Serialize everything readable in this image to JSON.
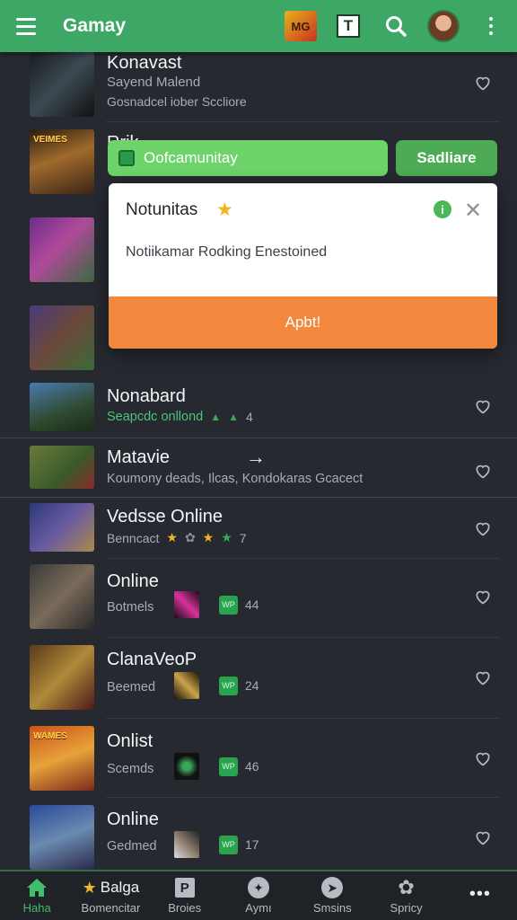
{
  "appbar": {
    "title": "Gamay",
    "logo_text": "MG",
    "t_icon": "T"
  },
  "promo": {
    "input_text": "Oofcamunitay",
    "button_label": "Sadliare"
  },
  "dialog": {
    "title": "Notunitas",
    "star": "★",
    "info": "i",
    "body": "Notiikamar Rodking Enestoined",
    "action": "Apbt!"
  },
  "rows": [
    {
      "title": "Konavast",
      "subtitle": "Sayend Malend",
      "subtitle2": "Gosnadcel iober Sccliore"
    },
    {
      "title": "Rrik",
      "badge": "VEIMES"
    },
    {
      "title": ""
    },
    {
      "title": ""
    },
    {
      "title": "Nonabard",
      "subtitle": "Seapcdc onllond",
      "count": "4"
    },
    {
      "title": "Matavie",
      "arrow": "→",
      "subtitle": "Koumony deads, Ilcas, Kondokaras Gcacect"
    },
    {
      "title": "Vedsse Online",
      "subtitle": "Benncact",
      "count": "7"
    },
    {
      "title": "Online",
      "subtitle": "Botmels",
      "badge_text": "WP",
      "count": "44"
    },
    {
      "title": "ClanaVeoP",
      "subtitle": "Beemed",
      "badge_text": "WP",
      "count": "24"
    },
    {
      "title": "Onlist",
      "subtitle": "Scemds",
      "badge_text": "WP",
      "count": "46",
      "thumb_text": "WAMES"
    },
    {
      "title": "Online",
      "subtitle": "Gedmed",
      "badge_text": "WP",
      "count": "17"
    }
  ],
  "bottom_nav": [
    {
      "label": "Haha",
      "icon": "home-icon"
    },
    {
      "label": "Bomencitar",
      "title": "Balga",
      "icon": "star-icon"
    },
    {
      "label": "Broies",
      "icon": "p-icon"
    },
    {
      "label": "Aymı",
      "icon": "gamepad-icon"
    },
    {
      "label": "Smsins",
      "icon": "compass-icon"
    },
    {
      "label": "Spricy",
      "icon": "puzzle-icon"
    },
    {
      "label": "",
      "icon": "more-icon"
    }
  ],
  "colors": {
    "accent": "#3da865",
    "background": "#262a30",
    "dialog_action": "#f2883d"
  }
}
